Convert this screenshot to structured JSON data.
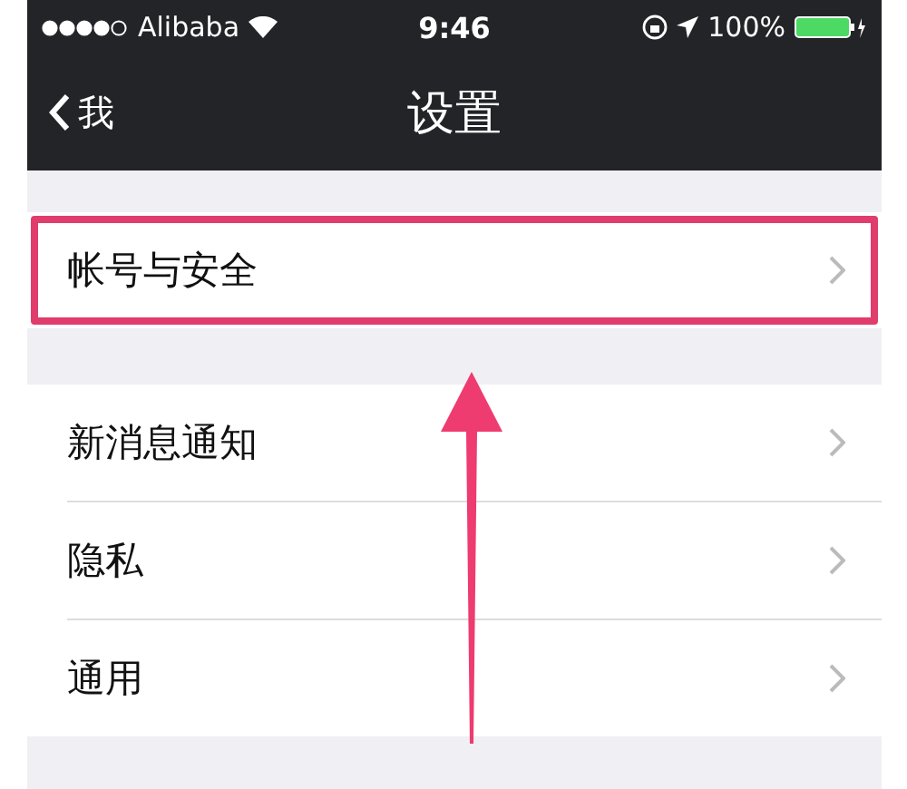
{
  "status_bar": {
    "carrier": "Alibaba",
    "time": "9:46",
    "battery": "100%"
  },
  "nav_bar": {
    "back": "我",
    "title": "设置"
  },
  "groups": [
    {
      "items": [
        {
          "label": "帐号与安全",
          "highlighted": true
        }
      ]
    },
    {
      "items": [
        {
          "label": "新消息通知",
          "highlighted": false
        },
        {
          "label": "隐私",
          "highlighted": false
        },
        {
          "label": "通用",
          "highlighted": false
        }
      ]
    }
  ],
  "annotation": {
    "kind": "arrow"
  }
}
